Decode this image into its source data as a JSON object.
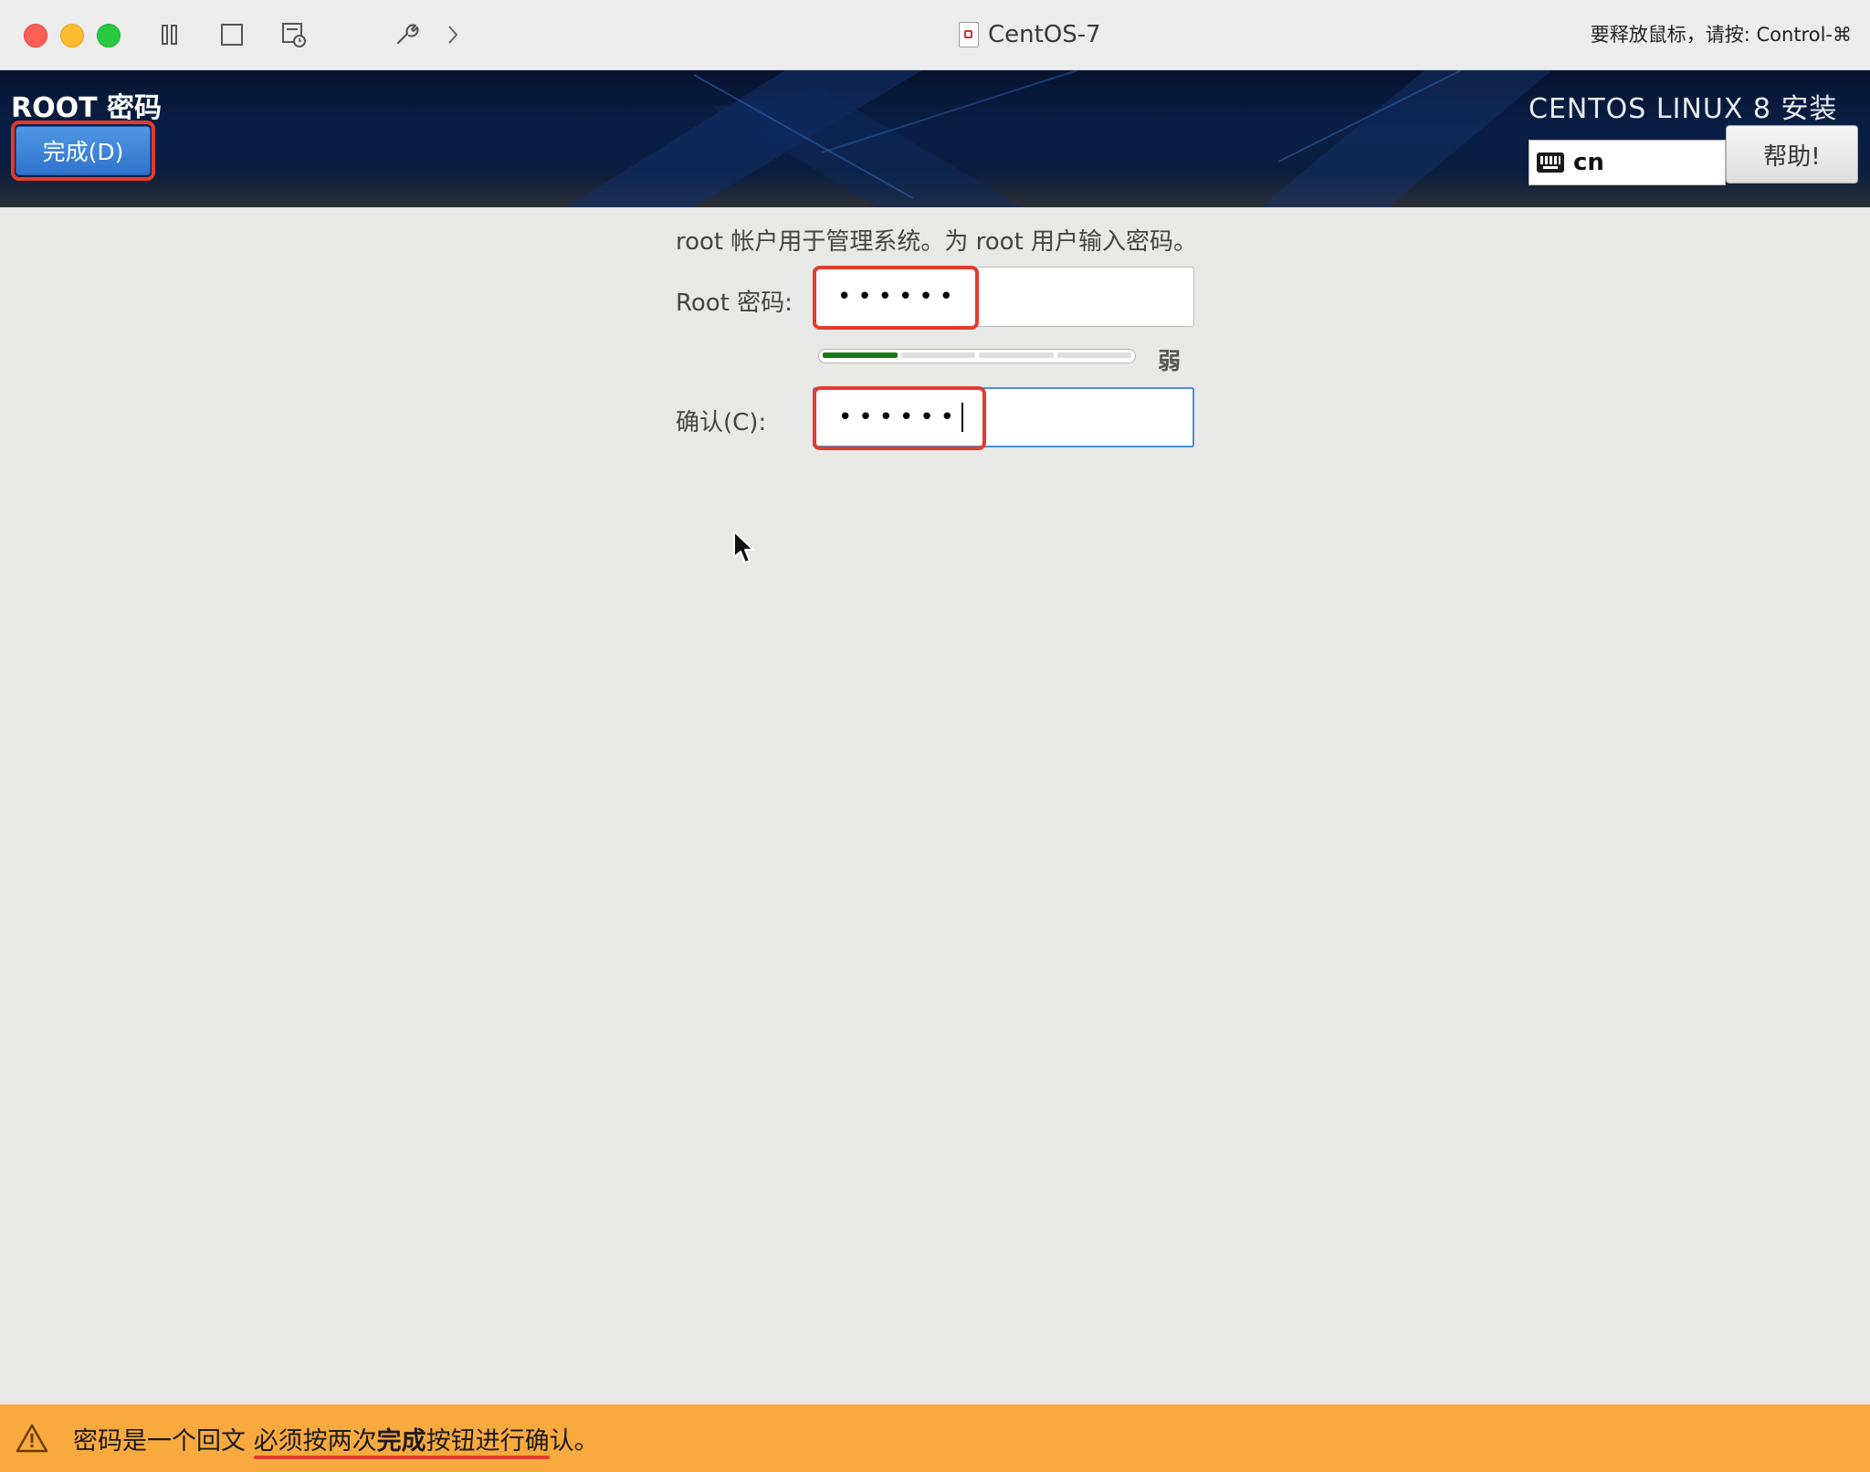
{
  "window": {
    "title": "CentOS-7",
    "release_hint": "要释放鼠标，请按: Control-⌘",
    "toolbar_icons": [
      "pause-icon",
      "stop-icon",
      "snapshot-icon",
      "settings-wrench-icon",
      "forward-icon"
    ]
  },
  "header": {
    "spoke_title": "ROOT 密码",
    "done_label": "完成(D)",
    "product_title": "CENTOS LINUX 8 安装",
    "keyboard_layout": "cn",
    "help_label": "帮助!"
  },
  "form": {
    "description": "root 帐户用于管理系统。为 root 用户输入密码。",
    "root_label": "Root 密码:",
    "root_value": "••••••",
    "strength_label": "弱",
    "strength_fraction": 0.25,
    "confirm_label": "确认(C):",
    "confirm_value": "••••••"
  },
  "warning": {
    "text_plain": "密码是一个回文 必须按两次",
    "text_bold": "完成",
    "text_tail": "按钮进行确认。"
  },
  "colors": {
    "done_button": "#2e73cc",
    "warning_bar": "#f9aa3e",
    "strength_fill": "#1a7a19",
    "highlight": "#e23b2e"
  }
}
